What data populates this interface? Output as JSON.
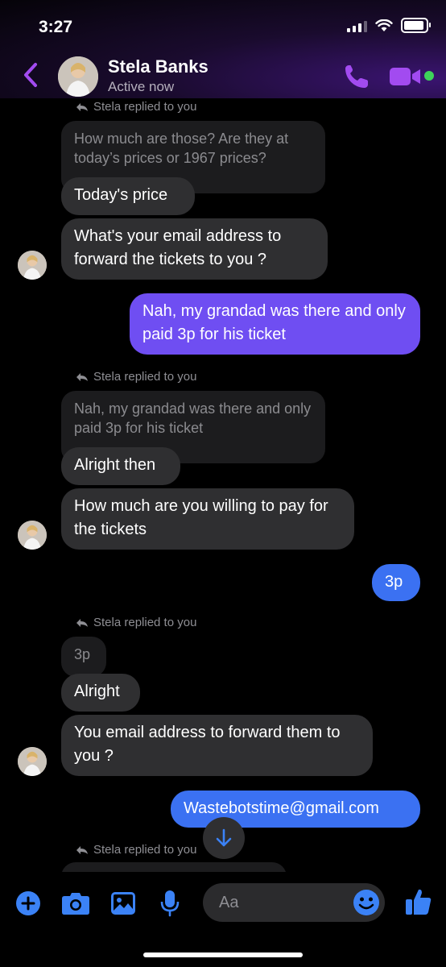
{
  "status_bar": {
    "time": "3:27"
  },
  "header": {
    "name": "Stela Banks",
    "status": "Active now"
  },
  "reply_label": "Stela replied to you",
  "messages": [
    {
      "type": "quote",
      "text": "How much are those? Are they at today’s prices or 1967 prices?"
    },
    {
      "type": "them",
      "text": "Today's price"
    },
    {
      "type": "them",
      "text": "What's your email address to forward the tickets to you ?"
    },
    {
      "type": "me",
      "text": "Nah, my grandad was there and only paid 3p for his ticket"
    },
    {
      "type": "quote",
      "text": "Nah, my grandad was there and only paid 3p for his ticket"
    },
    {
      "type": "them",
      "text": "Alright then"
    },
    {
      "type": "them",
      "text": "How much are you willing to pay for the tickets"
    },
    {
      "type": "me",
      "text": "3p"
    },
    {
      "type": "quote",
      "text": "3p"
    },
    {
      "type": "them",
      "text": "Alright"
    },
    {
      "type": "them",
      "text": "You email address to forward them to you ?"
    },
    {
      "type": "me",
      "text": "Wastebotstime@gmail.com"
    }
  ],
  "composer": {
    "placeholder": "Aa"
  },
  "colors": {
    "accent": "#a24bf0",
    "purple_bubble": "#6f4ef2",
    "blue_bubble": "#3b71f2",
    "composer_icons": "#3b82f6"
  }
}
